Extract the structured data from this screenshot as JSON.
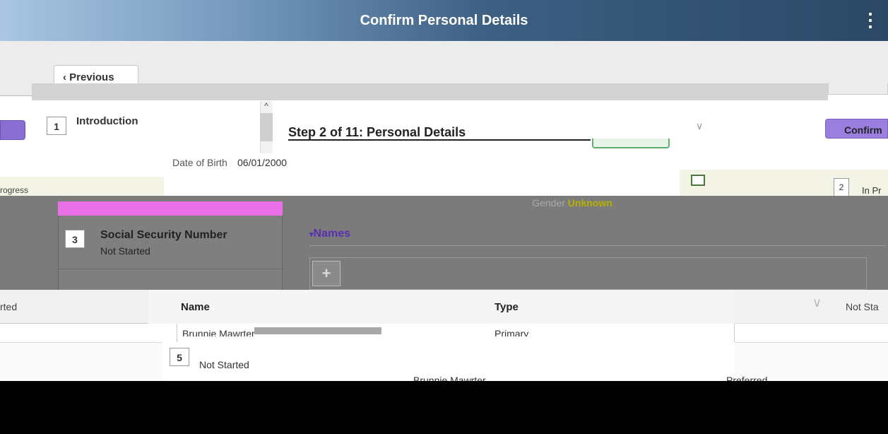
{
  "header": {
    "title": "Confirm Personal Details",
    "menu_icon": "more-vertical-icon"
  },
  "nav": {
    "previous_label": "Previous",
    "previous_icon": "chevron-left-icon"
  },
  "steps": [
    {
      "number": "1",
      "title": "Introduction",
      "status": ""
    },
    {
      "number": "3",
      "title": "Social Security Number",
      "status": "Not Started"
    },
    {
      "number": "5",
      "title": "",
      "status": "Not Started"
    }
  ],
  "main": {
    "step_title": "Step 2 of 11: Personal Details",
    "date_of_birth_label": "Date of Birth",
    "date_of_birth_value": "06/01/2000",
    "gender_label": "Gender",
    "gender_value": "Unknown",
    "confirm_label": "Confirm",
    "names_section_label": "Names",
    "add_icon": "plus-icon"
  },
  "names_table": {
    "columns": [
      "Name",
      "Type"
    ],
    "rows": [
      {
        "name": "Brunnie Mawrter",
        "type": "Primary"
      },
      {
        "name": "Brunnie Mawrter",
        "type": "Preferred"
      }
    ]
  },
  "status_labels": {
    "left_in_progress": "rogress",
    "left_not_started": "rted",
    "right_in_progress": "In Pr",
    "right_not_started": "Not Sta",
    "right_step_number": "2"
  },
  "colors": {
    "header_dark": "#2b4866",
    "header_light": "#a9c6e2",
    "accent_purple": "#8a6fd3",
    "names_link": "#5a2fb0",
    "overlay_gray": "#7b7b7b",
    "highlight_pink": "#e86fe6",
    "confirm_green": "#5fae6e"
  }
}
